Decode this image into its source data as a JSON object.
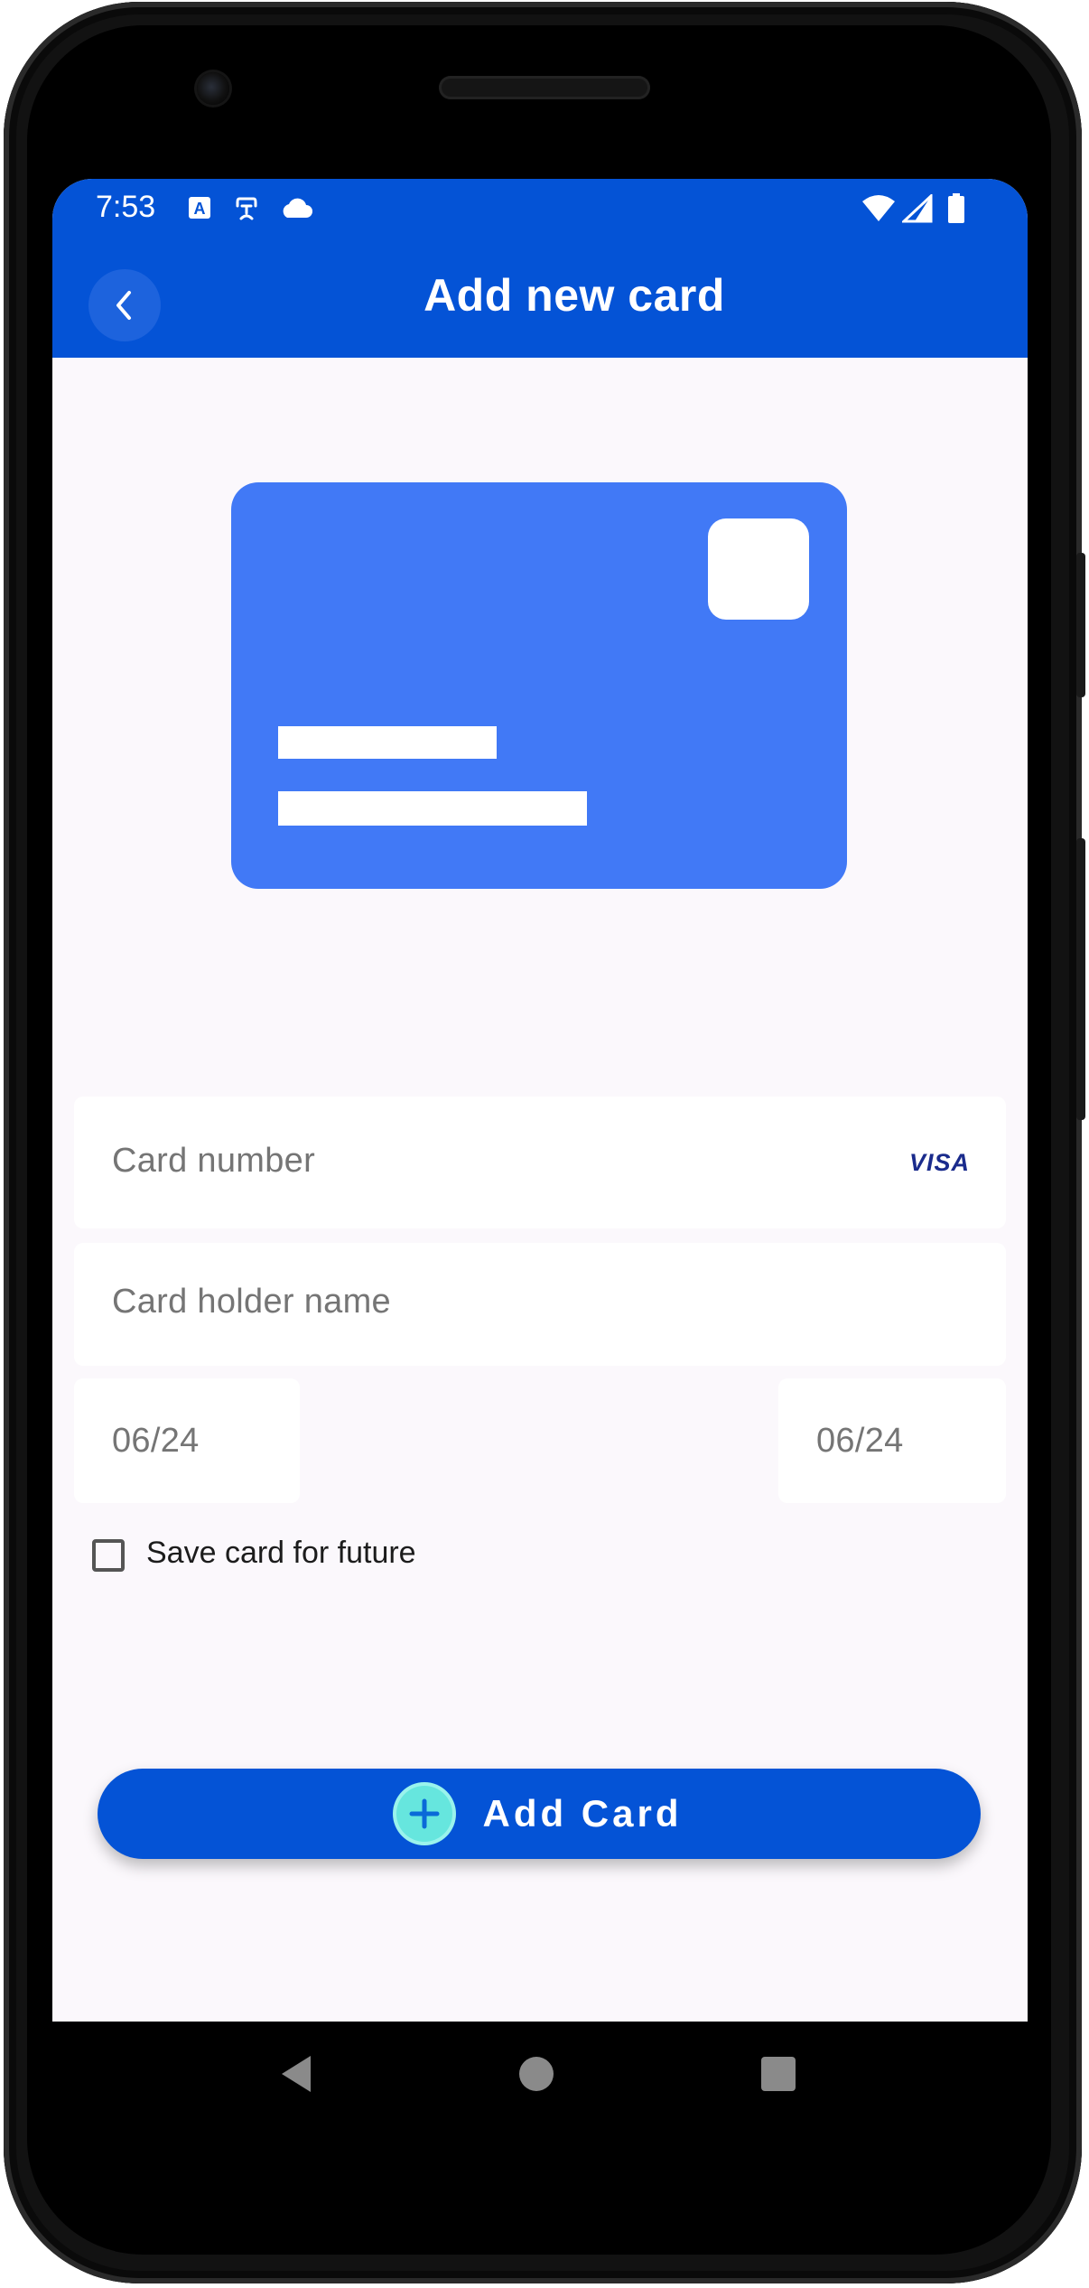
{
  "status_bar": {
    "time": "7:53",
    "icons": [
      "a-keyboard-icon",
      "accessibility-icon",
      "cloud-icon",
      "wifi-icon",
      "signal-icon",
      "battery-icon"
    ]
  },
  "app_bar": {
    "title": "Add new card",
    "back_icon": "chevron-left-icon",
    "color": "#0453d6"
  },
  "card_illustration": {
    "color": "#4179f6"
  },
  "form": {
    "card_number": {
      "placeholder": "Card number",
      "brand": "VISA"
    },
    "card_holder": {
      "placeholder": "Card holder name"
    },
    "expiry_left": {
      "placeholder": "06/24"
    },
    "expiry_right": {
      "placeholder": "06/24"
    },
    "save_card": {
      "label": "Save card for future",
      "checked": false
    }
  },
  "add_button": {
    "label": "Add Card",
    "icon": "plus-circle-icon",
    "icon_color": "#66e6de"
  },
  "nav_bar": {
    "items": [
      "back-nav-icon",
      "home-nav-icon",
      "recents-nav-icon"
    ]
  }
}
